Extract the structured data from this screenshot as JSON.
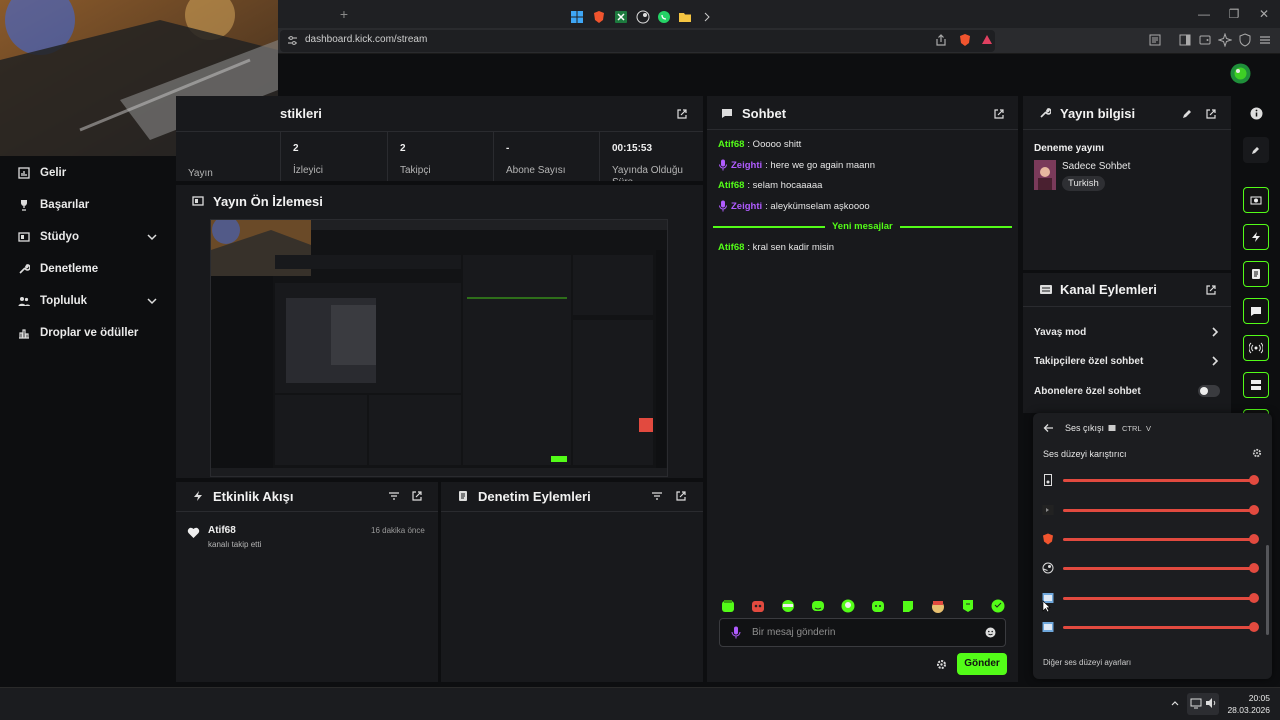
{
  "browser": {
    "new_tab": "+",
    "url": "dashboard.kick.com/stream",
    "window_min": "—",
    "window_max": "❐",
    "window_close": "✕"
  },
  "sidebar": {
    "items": [
      {
        "label": "Gelir",
        "icon": "chart-icon"
      },
      {
        "label": "Başarılar",
        "icon": "trophy-icon"
      },
      {
        "label": "Stüdyo",
        "icon": "studio-icon",
        "expand": true
      },
      {
        "label": "Denetleme",
        "icon": "wrench-icon"
      },
      {
        "label": "Topluluk",
        "icon": "community-icon",
        "expand": true
      },
      {
        "label": "Droplar ve ödüller",
        "icon": "drops-icon"
      }
    ]
  },
  "stats": {
    "title": "stikleri",
    "cells": [
      {
        "value": "",
        "label": "Yayın"
      },
      {
        "value": "2",
        "label": "İzleyici"
      },
      {
        "value": "2",
        "label": "Takipçi"
      },
      {
        "value": "-",
        "label": "Abone Sayısı"
      },
      {
        "value": "00:15:53",
        "label": "Yayında Olduğu Süre"
      }
    ]
  },
  "preview": {
    "title": "Yayın Ön İzlemesi"
  },
  "activity": {
    "title": "Etkinlik Akışı",
    "items": [
      {
        "user": "Atif68",
        "text": "kanalı takip etti",
        "time": "16 dakika önce"
      }
    ]
  },
  "moderation": {
    "title": "Denetim Eylemleri"
  },
  "chat": {
    "title": "Sohbet",
    "messages": [
      {
        "user": "Atif68",
        "text": ": Ooooo shitt",
        "color": "green",
        "mic": false
      },
      {
        "user": "Zeighti",
        "text": ": here we go again maann",
        "color": "purple",
        "mic": true
      },
      {
        "user": "Atif68",
        "text": ": selam hocaaaaa",
        "color": "green",
        "mic": false
      },
      {
        "user": "Zeighti",
        "text": ": aleykümselam aşkoooo",
        "color": "purple",
        "mic": true
      }
    ],
    "divider": "Yeni mesajlar",
    "new_messages": [
      {
        "user": "Atif68",
        "text": ": kral sen kadir misin"
      }
    ],
    "input_placeholder": "Bir mesaj gönderin",
    "send_label": "Gönder"
  },
  "stream_info": {
    "title": "Yayın bilgisi",
    "stream_title": "Deneme yayını",
    "category": "Sadece Sohbet",
    "tag": "Turkish"
  },
  "channel_actions": {
    "title": "Kanal Eylemleri",
    "rows": [
      {
        "label": "Yavaş mod",
        "control": "chevron"
      },
      {
        "label": "Takipçilere özel sohbet",
        "control": "chevron"
      },
      {
        "label": "Abonelere özel sohbet",
        "control": "toggle"
      }
    ]
  },
  "mixer": {
    "back_label": "Ses çıkışı",
    "shortcut_key1": "CTRL",
    "shortcut_key2": "V",
    "title": "Ses düzeyi karıştırıcı",
    "footer": "Diğer ses düzeyi ayarları",
    "rows": [
      {
        "icon": "device-icon",
        "level": 1.0
      },
      {
        "icon": "app-icon",
        "level": 1.0
      },
      {
        "icon": "brave-icon",
        "level": 1.0
      },
      {
        "icon": "steam-icon",
        "level": 1.0
      },
      {
        "icon": "window-icon",
        "level": 1.0
      },
      {
        "icon": "window-icon",
        "level": 1.0
      }
    ]
  },
  "taskbar": {
    "time": "20:05",
    "date": "28.03.2026"
  },
  "colors": {
    "accent": "#53fc18",
    "purple": "#b05cff",
    "red": "#e24a3f"
  }
}
